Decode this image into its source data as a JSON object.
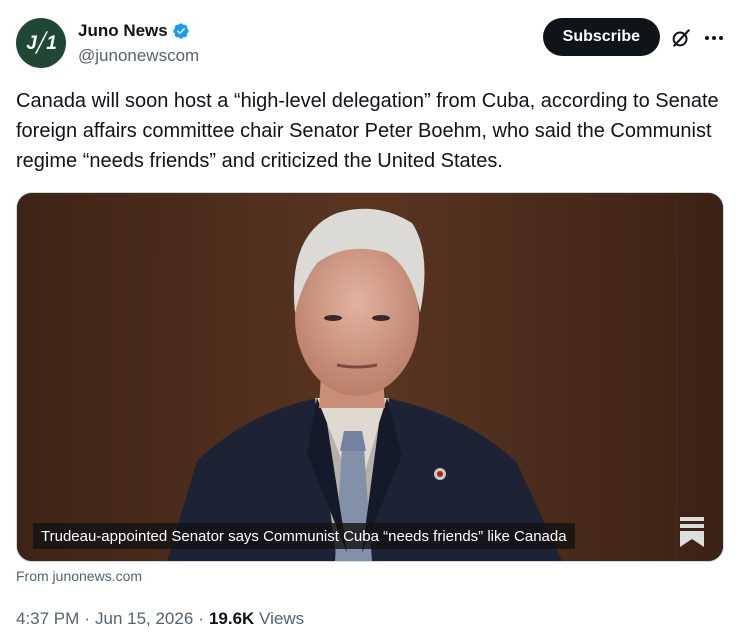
{
  "author": {
    "avatar_text": "J≰1",
    "display_name": "Juno News",
    "handle": "@junonewscom",
    "verified_icon": "verified-badge-icon"
  },
  "actions": {
    "subscribe_label": "Subscribe",
    "grok_icon": "grok-icon",
    "more_icon": "more-options-icon"
  },
  "tweet": {
    "text": "Canada will soon host a “high-level delegation” from Cuba, according to Senate foreign affairs committee chair Senator Peter Boehm, who said the Communist regime “needs friends” and criticized the United States."
  },
  "media": {
    "caption": "Trudeau-appointed Senator says Communist Cuba “needs friends” like Canada",
    "bookmark_icon": "bookmark-icon"
  },
  "source": "From junonews.com",
  "meta": {
    "time": "4:37 PM",
    "sep1": "·",
    "date": "Jun 15, 2026",
    "sep2": "·",
    "views_count": "19.6K",
    "views_label": "Views"
  },
  "colors": {
    "accent": "#1d9bf0",
    "brand": "#1f4734",
    "text": "#0f1419",
    "secondary": "#536471"
  }
}
